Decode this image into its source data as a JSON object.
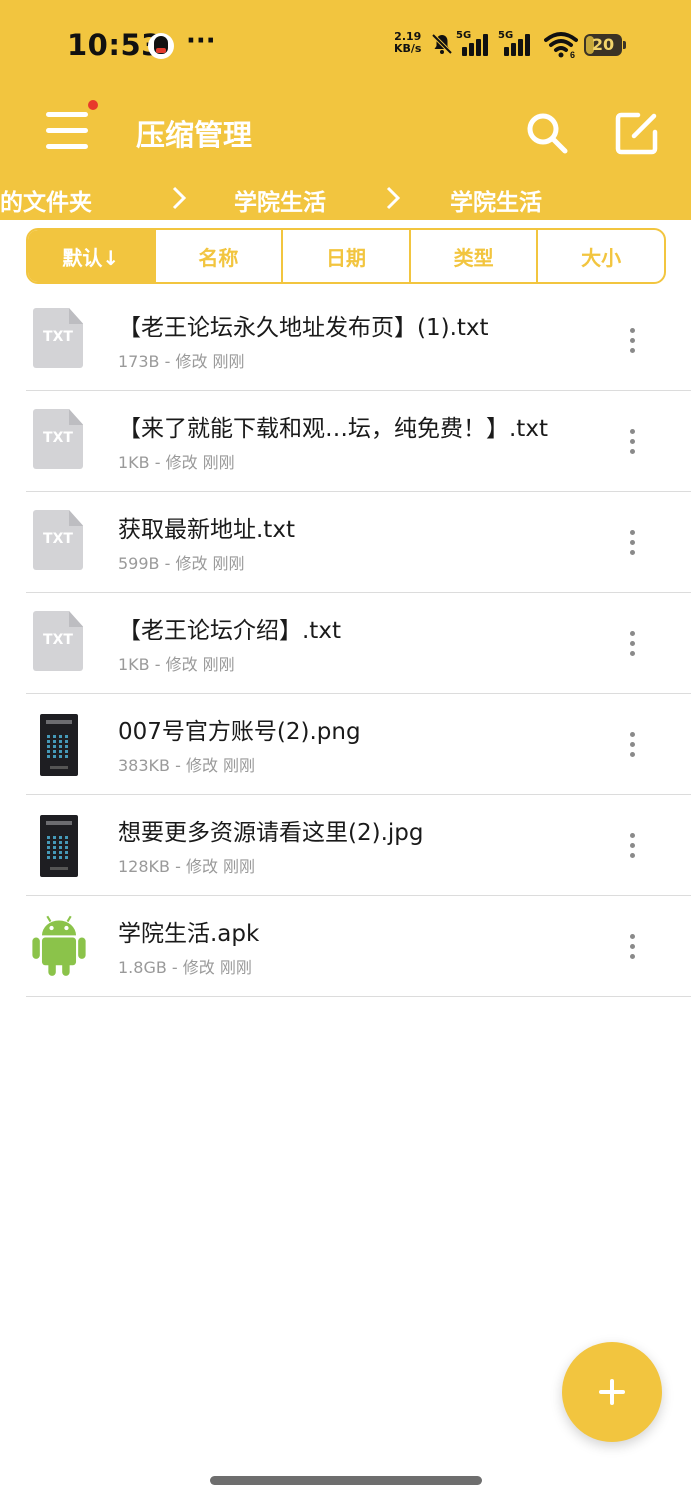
{
  "status_bar": {
    "time": "10:53",
    "more": "···",
    "net_speed_value": "2.19",
    "net_speed_unit": "KB/s",
    "sim1_label": "5G",
    "sim2_label": "5G",
    "wifi_badge": "6",
    "battery_level": "20",
    "icons": [
      "qq-icon",
      "bell-muted-icon",
      "signal-icon",
      "signal-icon",
      "wifi-icon",
      "battery-icon"
    ]
  },
  "app_bar": {
    "title": "压缩管理",
    "icons": [
      "menu-icon",
      "search-icon",
      "edit-icon"
    ],
    "accent_color": "#F2C53F",
    "notification_dot_color": "#E8392B"
  },
  "breadcrumb": [
    "的文件夹",
    "学院生活",
    "学院生活"
  ],
  "sort_tabs": [
    {
      "label": "默认↓",
      "active": true
    },
    {
      "label": "名称",
      "active": false
    },
    {
      "label": "日期",
      "active": false
    },
    {
      "label": "类型",
      "active": false
    },
    {
      "label": "大小",
      "active": false
    }
  ],
  "files": [
    {
      "name": "【老王论坛永久地址发布页】(1).txt",
      "meta": "173B - 修改 刚刚",
      "icon": "txt-file-icon",
      "icon_label": "TXT"
    },
    {
      "name": "【来了就能下载和观…坛，纯免费！】.txt",
      "meta": "1KB - 修改 刚刚",
      "icon": "txt-file-icon",
      "icon_label": "TXT"
    },
    {
      "name": "获取最新地址.txt",
      "meta": "599B - 修改 刚刚",
      "icon": "txt-file-icon",
      "icon_label": "TXT"
    },
    {
      "name": "【老王论坛介绍】.txt",
      "meta": "1KB - 修改 刚刚",
      "icon": "txt-file-icon",
      "icon_label": "TXT"
    },
    {
      "name": "007号官方账号(2).png",
      "meta": "383KB - 修改 刚刚",
      "icon": "image-thumbnail",
      "icon_label": ""
    },
    {
      "name": "想要更多资源请看这里(2).jpg",
      "meta": "128KB - 修改 刚刚",
      "icon": "image-thumbnail",
      "icon_label": ""
    },
    {
      "name": "学院生活.apk",
      "meta": "1.8GB - 修改 刚刚",
      "icon": "android-icon",
      "icon_label": ""
    }
  ],
  "fab": {
    "icon": "plus-icon"
  }
}
